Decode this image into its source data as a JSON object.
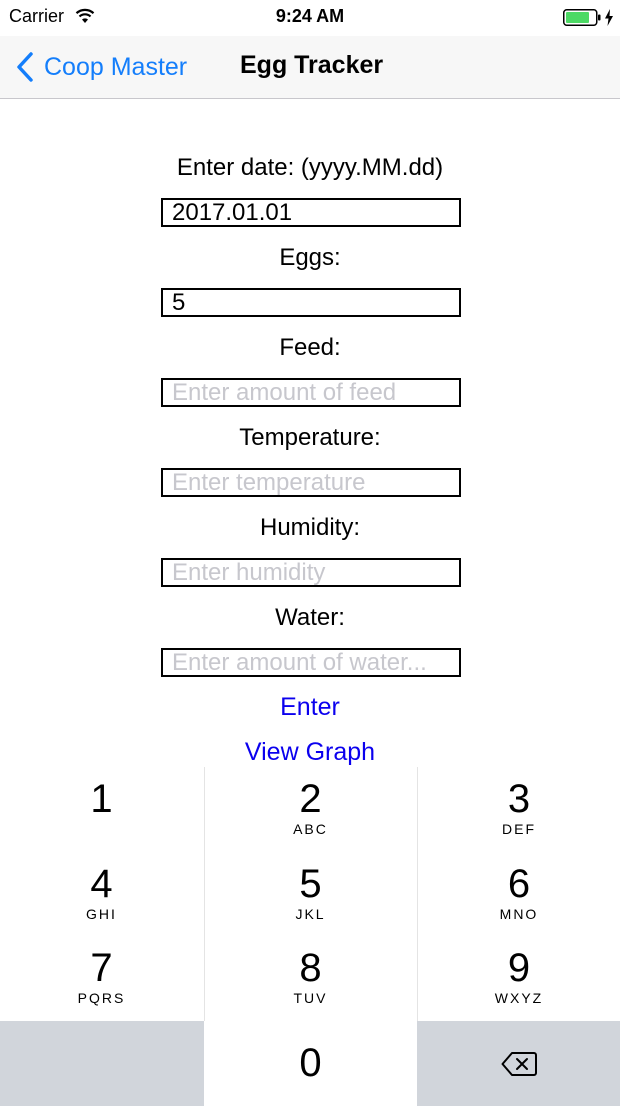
{
  "status_bar": {
    "carrier": "Carrier",
    "time": "9:24 AM",
    "battery_color": "#4cd964"
  },
  "nav": {
    "back_label": "Coop Master",
    "title": "Egg Tracker",
    "accent_color": "#147efb"
  },
  "form": {
    "date_label": "Enter date: (yyyy.MM.dd)",
    "date_value": "2017.01.01",
    "eggs_label": "Eggs:",
    "eggs_value": "5",
    "feed_label": "Feed:",
    "feed_placeholder": "Enter amount of feed",
    "temperature_label": "Temperature:",
    "temperature_placeholder": "Enter temperature",
    "humidity_label": "Humidity:",
    "humidity_placeholder": "Enter humidity",
    "water_label": "Water:",
    "water_placeholder": "Enter amount of water..."
  },
  "actions": {
    "enter_label": "Enter",
    "view_graph_label": "View Graph",
    "link_color": "#0b00ee"
  },
  "keypad": {
    "keys": [
      {
        "digit": "1",
        "letters": ""
      },
      {
        "digit": "2",
        "letters": "ABC"
      },
      {
        "digit": "3",
        "letters": "DEF"
      },
      {
        "digit": "4",
        "letters": "GHI"
      },
      {
        "digit": "5",
        "letters": "JKL"
      },
      {
        "digit": "6",
        "letters": "MNO"
      },
      {
        "digit": "7",
        "letters": "PQRS"
      },
      {
        "digit": "8",
        "letters": "TUV"
      },
      {
        "digit": "9",
        "letters": "WXYZ"
      },
      {
        "digit": "0",
        "letters": ""
      }
    ],
    "delete_icon": "backspace-icon"
  }
}
